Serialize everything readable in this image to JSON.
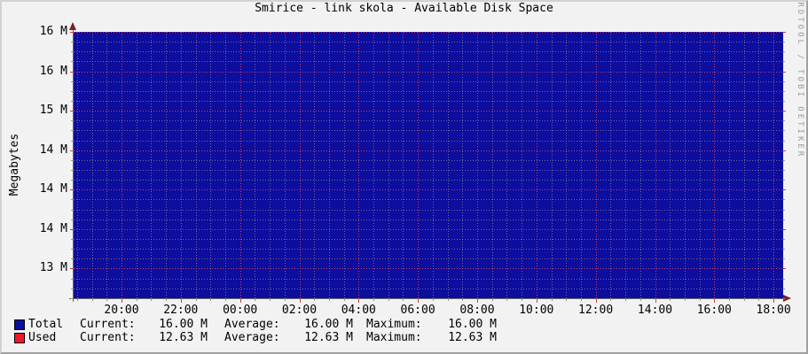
{
  "title": "Smirice - link skola - Available Disk Space",
  "watermark": "RRDTOOL / TOBI OETIKER",
  "y_axis_title": "Megabytes",
  "chart_data": {
    "type": "area",
    "title": "Smirice - link skola - Available Disk Space",
    "xlabel": "",
    "ylabel": "Megabytes",
    "x_tick_labels": [
      "20:00",
      "22:00",
      "00:00",
      "02:00",
      "04:00",
      "06:00",
      "08:00",
      "10:00",
      "12:00",
      "14:00",
      "16:00",
      "18:00"
    ],
    "y_tick_labels": [
      "16 M",
      "16 M",
      "15 M",
      "14 M",
      "14 M",
      "14 M",
      "13 M"
    ],
    "y_tick_values_megabytes": [
      16.0,
      15.5,
      15.0,
      14.5,
      14.0,
      13.5,
      13.0
    ],
    "ylim_megabytes": [
      12.62,
      16.0
    ],
    "grid": {
      "shown": true,
      "minors_per_major_x": 4,
      "minors_per_major_y": 4
    },
    "legend_position": "bottom",
    "series": [
      {
        "name": "Total",
        "style": "area",
        "color": "#0d0d9e",
        "value_megabytes": 16.0,
        "current": "16.00 M",
        "average": "16.00 M",
        "maximum": "16.00 M"
      },
      {
        "name": "Used",
        "style": "line",
        "color": "#f0182b",
        "value_megabytes": 12.63,
        "current": "12.63 M",
        "average": "12.63 M",
        "maximum": "12.63 M"
      }
    ]
  },
  "legend": {
    "col_headers": [
      "Current:",
      "Average:",
      "Maximum:"
    ],
    "rows": [
      {
        "name": "Total",
        "swatch_color": "#0d0d9e",
        "values": [
          "16.00 M",
          "16.00 M",
          "16.00 M"
        ]
      },
      {
        "name": "Used",
        "swatch_color": "#f0182b",
        "values": [
          "12.63 M",
          "12.63 M",
          "12.63 M"
        ]
      }
    ]
  },
  "colors": {
    "background": "#f2f2f2",
    "area_fill": "#0d0d9e",
    "grid_major": "#ff4d4d",
    "grid_minor": "#9c9c9c",
    "arrow": "#7f2020",
    "axis": "#6a6a6a",
    "text": "#000000",
    "watermark_text": "#9a9a9a",
    "border_light": "#d2d2d2",
    "border_dark": "#9fa09f"
  }
}
